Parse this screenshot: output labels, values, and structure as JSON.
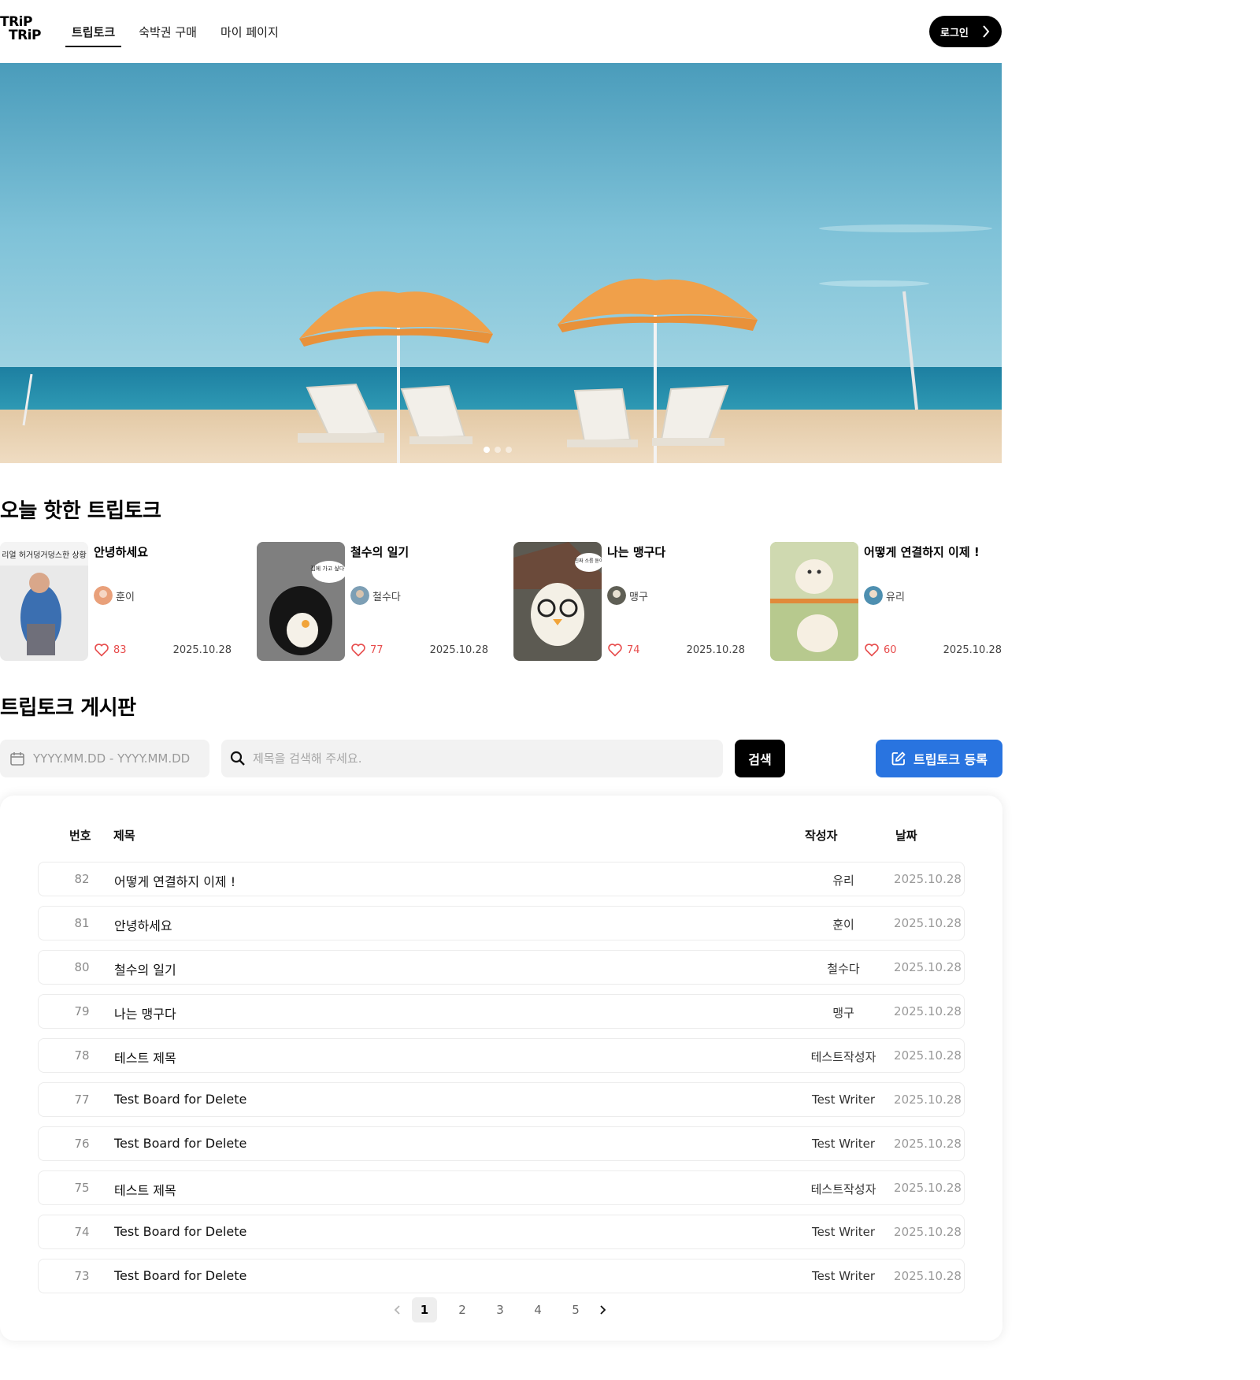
{
  "header": {
    "logo_line1": "TRiP",
    "logo_line2": "TRiP",
    "tabs": [
      {
        "label": "트립토크",
        "active": true
      },
      {
        "label": "숙박권 구매",
        "active": false
      },
      {
        "label": "마이 페이지",
        "active": false
      }
    ],
    "login_label": "로그인"
  },
  "hero": {
    "slides": 3,
    "active_slide": 1
  },
  "hot": {
    "title": "오늘 핫한 트립토크",
    "cards": [
      {
        "title": "안녕하세요",
        "thumb_caption": "리얼 허거덩거덩스한 상황",
        "author": "훈이",
        "likes": "83",
        "date": "2025.10.28"
      },
      {
        "title": "철수의 일기",
        "thumb_caption": "집에 가고 싶다..",
        "author": "철수다",
        "likes": "77",
        "date": "2025.10.28"
      },
      {
        "title": "나는 맹구다",
        "thumb_caption": "진짜 소름 돋아",
        "author": "맹구",
        "likes": "74",
        "date": "2025.10.28"
      },
      {
        "title": "어떻게 연결하지 이제 !",
        "thumb_caption": "",
        "author": "유리",
        "likes": "60",
        "date": "2025.10.28"
      }
    ]
  },
  "board": {
    "title": "트립토크 게시판",
    "date_placeholder": "YYYY.MM.DD - YYYY.MM.DD",
    "search_placeholder": "제목을 검색해 주세요.",
    "search_label": "검색",
    "write_label": "트립토크 등록",
    "columns": {
      "no": "번호",
      "title": "제목",
      "writer": "작성자",
      "date": "날짜"
    },
    "rows": [
      {
        "no": "82",
        "title": "어떻게 연결하지 이제 !",
        "writer": "유리",
        "date": "2025.10.28"
      },
      {
        "no": "81",
        "title": "안녕하세요",
        "writer": "훈이",
        "date": "2025.10.28"
      },
      {
        "no": "80",
        "title": "철수의 일기",
        "writer": "철수다",
        "date": "2025.10.28"
      },
      {
        "no": "79",
        "title": "나는 맹구다",
        "writer": "맹구",
        "date": "2025.10.28"
      },
      {
        "no": "78",
        "title": "테스트 제목",
        "writer": "테스트작성자",
        "date": "2025.10.28"
      },
      {
        "no": "77",
        "title": "Test Board for Delete",
        "writer": "Test Writer",
        "date": "2025.10.28"
      },
      {
        "no": "76",
        "title": "Test Board for Delete",
        "writer": "Test Writer",
        "date": "2025.10.28"
      },
      {
        "no": "75",
        "title": "테스트 제목",
        "writer": "테스트작성자",
        "date": "2025.10.28"
      },
      {
        "no": "74",
        "title": "Test Board for Delete",
        "writer": "Test Writer",
        "date": "2025.10.28"
      },
      {
        "no": "73",
        "title": "Test Board for Delete",
        "writer": "Test Writer",
        "date": "2025.10.28"
      }
    ],
    "pages": [
      "1",
      "2",
      "3",
      "4",
      "5"
    ],
    "current_page": "1"
  },
  "colors": {
    "accent": "#2974e0",
    "like": "#e74c4c",
    "primary": "#000000"
  },
  "icons": [
    "chevron-right-icon",
    "calendar-icon",
    "search-icon",
    "edit-icon",
    "heart-icon",
    "chevron-left-icon"
  ]
}
